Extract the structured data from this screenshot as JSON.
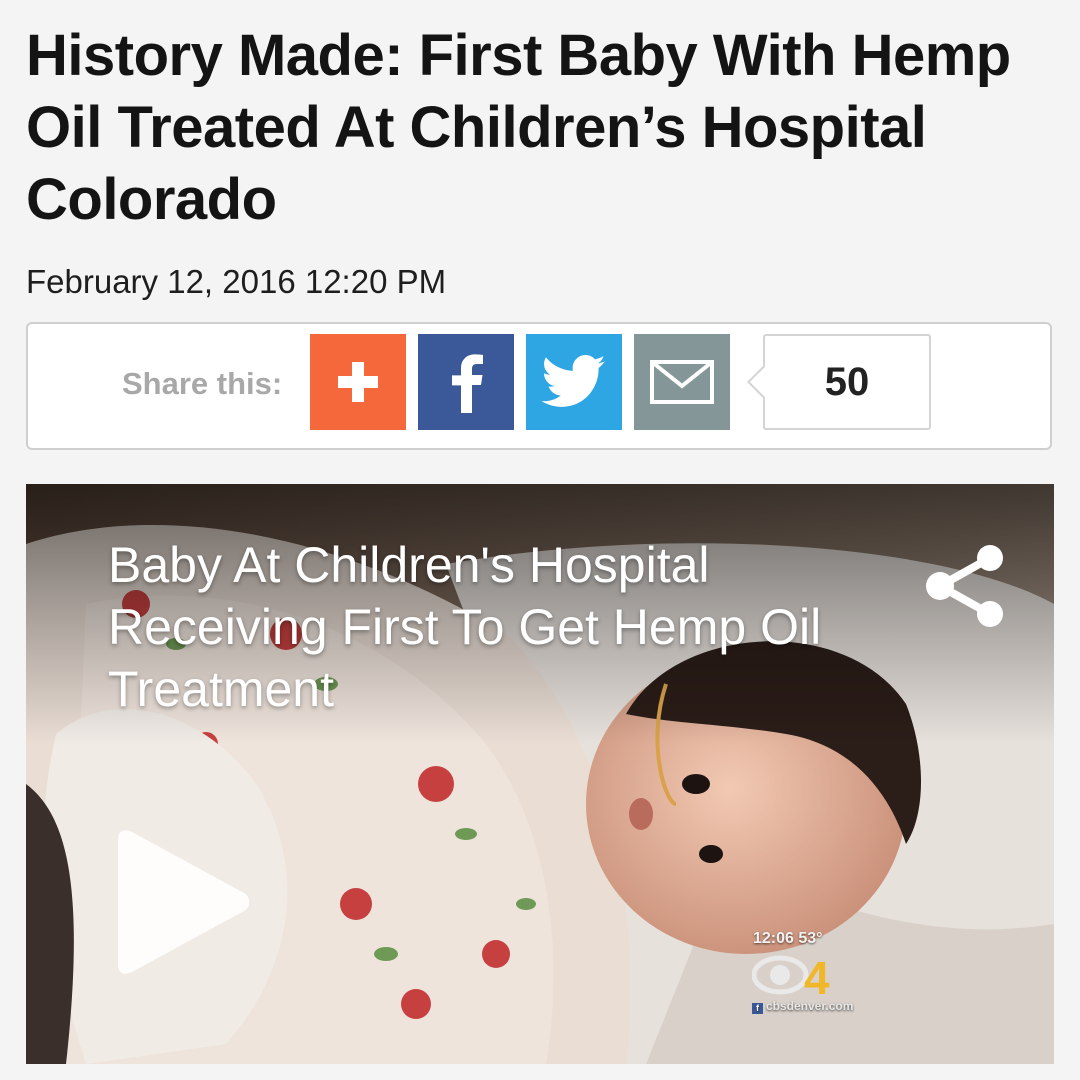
{
  "article": {
    "headline": "History Made: First Baby With Hemp Oil Treated At Children’s Hospital Colorado",
    "timestamp": "February 12, 2016 12:20 PM"
  },
  "share_bar": {
    "label": "Share this:",
    "buttons": [
      {
        "name": "addthis",
        "icon": "plus-icon",
        "color": "#f4683c"
      },
      {
        "name": "facebook",
        "icon": "facebook-icon",
        "color": "#3b5998"
      },
      {
        "name": "twitter",
        "icon": "twitter-bird-icon",
        "color": "#2fa6e4"
      },
      {
        "name": "email",
        "icon": "envelope-icon",
        "color": "#849698"
      }
    ],
    "share_count": "50"
  },
  "video": {
    "title": "Baby At Children's Hospital Receiving First To Get Hemp Oil Treatment",
    "share_icon": "share-icon",
    "play_icon": "play-icon",
    "station": {
      "time_temp": "12:06  53°",
      "logo": "CBS 4",
      "url": "cbsdenver.com"
    }
  }
}
